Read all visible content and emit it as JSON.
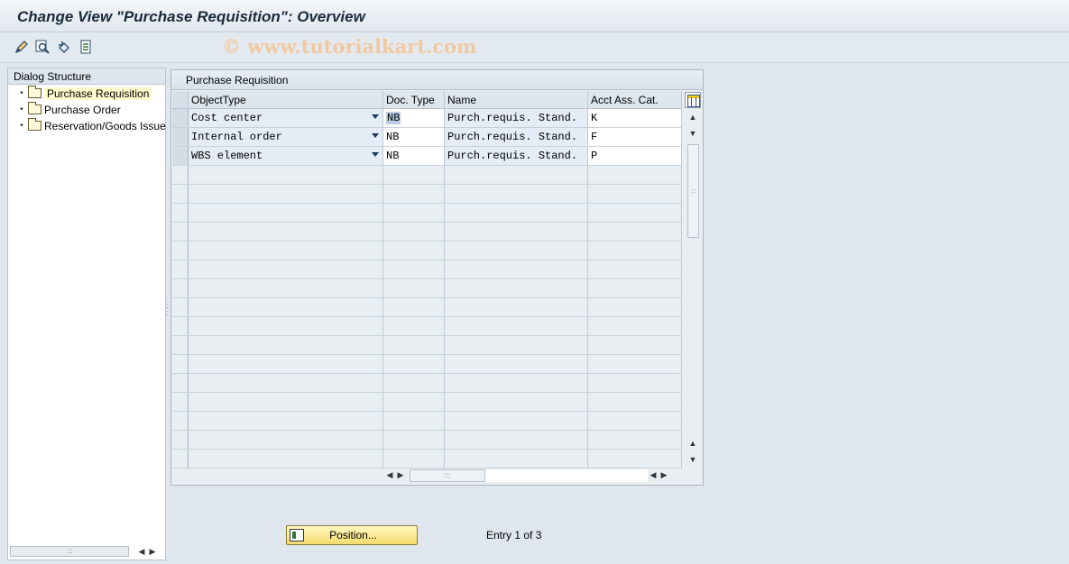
{
  "window": {
    "title": "Change View \"Purchase Requisition\": Overview"
  },
  "toolbar": {
    "icons": [
      "edit-pencil-icon",
      "display-search-icon",
      "undo-icon",
      "details-icon"
    ],
    "watermark": "© www.tutorialkart.com"
  },
  "left_panel": {
    "header": "Dialog Structure",
    "items": [
      {
        "label": "Purchase Requisition",
        "selected": true
      },
      {
        "label": "Purchase Order",
        "selected": false
      },
      {
        "label": "Reservation/Goods Issue",
        "selected": false
      }
    ]
  },
  "table": {
    "caption": "Purchase Requisition",
    "headers": {
      "object_type": "ObjectType",
      "doc_type": "Doc. Type",
      "name": "Name",
      "acct": "Acct Ass. Cat."
    },
    "rows": [
      {
        "object_type": "Cost center",
        "doc_type": "NB",
        "name": "Purch.requis. Stand.",
        "acct": "K"
      },
      {
        "object_type": "Internal order",
        "doc_type": "NB",
        "name": "Purch.requis. Stand.",
        "acct": "F"
      },
      {
        "object_type": "WBS element",
        "doc_type": "NB",
        "name": "Purch.requis. Stand.",
        "acct": "P"
      }
    ]
  },
  "footer": {
    "position_button": "Position...",
    "entry_text": "Entry 1 of 3"
  }
}
